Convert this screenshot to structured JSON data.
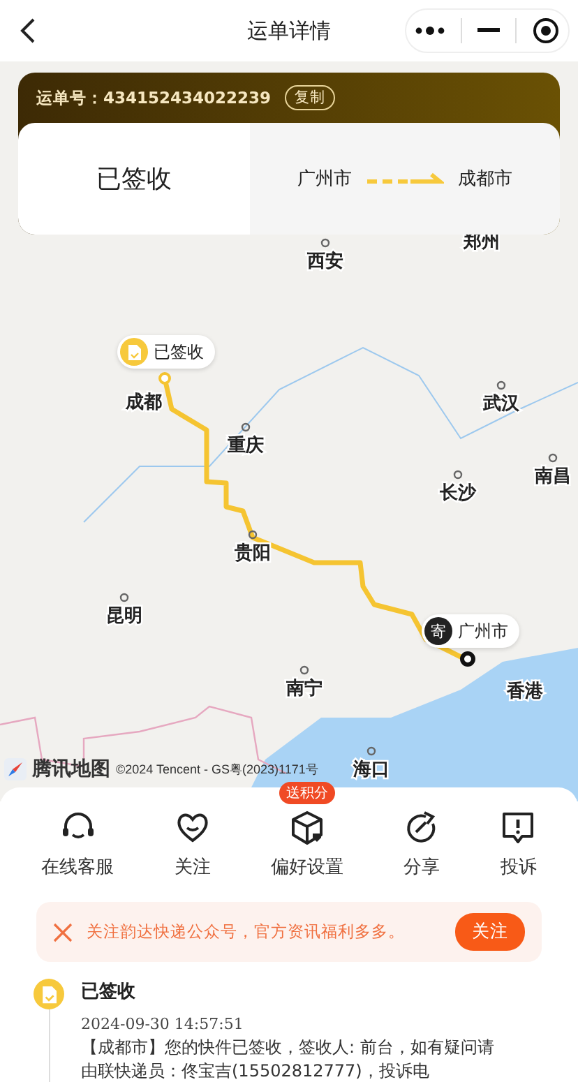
{
  "nav": {
    "title": "运单详情"
  },
  "waybill": {
    "number": "运单号：434152434022239",
    "copy": "复制",
    "status": "已签收",
    "from": "广州市",
    "to": "成都市"
  },
  "map": {
    "cities": [
      "郑州",
      "西安",
      "成都",
      "重庆",
      "武汉",
      "南昌",
      "长沙",
      "贵阳",
      "昆明",
      "南宁",
      "香港",
      "海口"
    ],
    "end_marker": {
      "glyph": "已签收"
    },
    "start_marker": {
      "glyph": "寄",
      "label": "广州市"
    },
    "logo": "腾讯地图",
    "copyright": "©2024 Tencent - GS粤(2023)1171号"
  },
  "actions": [
    {
      "label": "在线客服"
    },
    {
      "label": "关注"
    },
    {
      "label": "偏好设置",
      "badge": "送积分"
    },
    {
      "label": "分享"
    },
    {
      "label": "投诉"
    }
  ],
  "banner": {
    "text": "关注韵达快递公众号，官方资讯福利多多。",
    "button": "关注"
  },
  "timeline": [
    {
      "status": "已签收",
      "time": "2024-09-30 14:57:51",
      "text": "【成都市】您的快件已签收，签收人: 前台，如有疑问请",
      "text2": "由联快递员：佟宝吉(15502812777)，投诉电"
    }
  ]
}
